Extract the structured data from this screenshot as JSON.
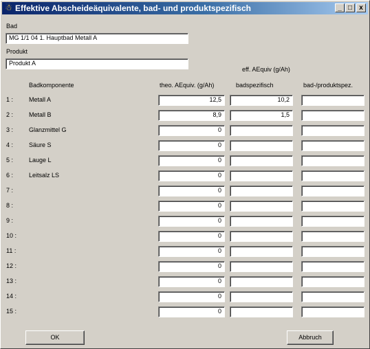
{
  "window": {
    "title": "Effektive Abscheideäquivalente, bad- und produktspezifisch",
    "controls": {
      "minimize": "_",
      "maximize": "□",
      "close": "x"
    }
  },
  "bad": {
    "label": "Bad",
    "value": "MG 1/1 04 1. Hauptbad Metall A"
  },
  "produkt": {
    "label": "Produkt",
    "value": "Produkt A"
  },
  "headers": {
    "eff_group": "eff. AEquiv (g/Ah)",
    "komponente": "Badkomponente",
    "theo": "theo. AEquiv. (g/Ah)",
    "badspez": "badspezifisch",
    "produktspez": "bad-/produktspez."
  },
  "rows": [
    {
      "num": "1 :",
      "name": "Metall A",
      "theo": "12,5",
      "badspez": "10,2",
      "produktspez": ""
    },
    {
      "num": "2 :",
      "name": "Metall B",
      "theo": "8,9",
      "badspez": "1,5",
      "produktspez": ""
    },
    {
      "num": "3 :",
      "name": "Glanzmittel G",
      "theo": "0",
      "badspez": "",
      "produktspez": ""
    },
    {
      "num": "4 :",
      "name": "Säure S",
      "theo": "0",
      "badspez": "",
      "produktspez": ""
    },
    {
      "num": "5 :",
      "name": "Lauge L",
      "theo": "0",
      "badspez": "",
      "produktspez": ""
    },
    {
      "num": "6 :",
      "name": "Leitsalz LS",
      "theo": "0",
      "badspez": "",
      "produktspez": ""
    },
    {
      "num": "7 :",
      "name": "",
      "theo": "0",
      "badspez": "",
      "produktspez": ""
    },
    {
      "num": "8 :",
      "name": "",
      "theo": "0",
      "badspez": "",
      "produktspez": ""
    },
    {
      "num": "9 :",
      "name": "",
      "theo": "0",
      "badspez": "",
      "produktspez": ""
    },
    {
      "num": "10 :",
      "name": "",
      "theo": "0",
      "badspez": "",
      "produktspez": ""
    },
    {
      "num": "11 :",
      "name": "",
      "theo": "0",
      "badspez": "",
      "produktspez": ""
    },
    {
      "num": "12 :",
      "name": "",
      "theo": "0",
      "badspez": "",
      "produktspez": ""
    },
    {
      "num": "13 :",
      "name": "",
      "theo": "0",
      "badspez": "",
      "produktspez": ""
    },
    {
      "num": "14 :",
      "name": "",
      "theo": "0",
      "badspez": "",
      "produktspez": ""
    },
    {
      "num": "15 :",
      "name": "",
      "theo": "0",
      "badspez": "",
      "produktspez": ""
    }
  ],
  "buttons": {
    "ok": "OK",
    "cancel": "Abbruch"
  }
}
